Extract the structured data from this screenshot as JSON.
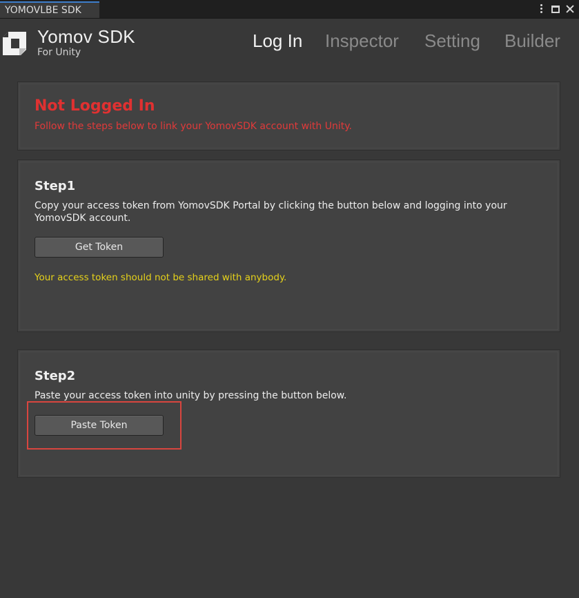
{
  "window": {
    "tab_title": "YOMOVLBE SDK",
    "icons": [
      "kebab-menu-icon",
      "maximize-icon",
      "close-icon"
    ]
  },
  "header": {
    "brand_title": "Yomov SDK",
    "brand_subtitle": "For Unity",
    "nav": [
      {
        "label": "Log In",
        "active": true
      },
      {
        "label": "Inspector",
        "active": false
      },
      {
        "label": "Setting",
        "active": false
      },
      {
        "label": "Builder",
        "active": false
      }
    ]
  },
  "status": {
    "title": "Not Logged In",
    "message": "Follow the steps below to link your YomovSDK account with Unity.",
    "color": "#e03131"
  },
  "step1": {
    "title": "Step1",
    "description": "Copy your access token from YomovSDK Portal by clicking the button below and logging into your YomovSDK account.",
    "button_label": "Get Token",
    "warning": "Your access token should not be shared with anybody."
  },
  "step2": {
    "title": "Step2",
    "description": "Paste your access token into unity by pressing the button below.",
    "button_label": "Paste Token"
  },
  "colors": {
    "accent_tab": "#3d7fcc",
    "warning": "#e6d21a",
    "highlight_box": "#d9453f"
  }
}
